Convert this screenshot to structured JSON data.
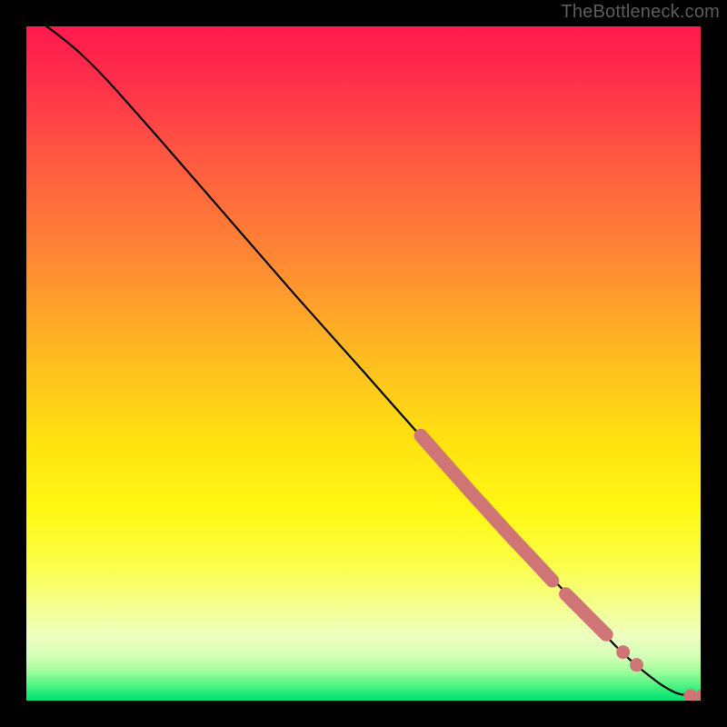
{
  "attribution": "TheBottleneck.com",
  "chart_data": {
    "type": "line",
    "title": "",
    "xlabel": "",
    "ylabel": "",
    "xlim": [
      0,
      100
    ],
    "ylim": [
      0,
      100
    ],
    "grid": false,
    "legend": false,
    "curve": {
      "points_xy": [
        [
          3,
          100
        ],
        [
          5,
          98.5
        ],
        [
          8,
          96
        ],
        [
          12,
          92
        ],
        [
          20,
          83
        ],
        [
          30,
          71.5
        ],
        [
          40,
          60
        ],
        [
          50,
          48.8
        ],
        [
          60,
          37.5
        ],
        [
          70,
          26.5
        ],
        [
          80,
          16
        ],
        [
          88,
          7.5
        ],
        [
          93,
          3.2
        ],
        [
          96,
          1.3
        ],
        [
          98,
          0.8
        ],
        [
          100,
          0.7
        ]
      ]
    },
    "series": [
      {
        "name": "highlight-segment-1",
        "color": "#cf7575",
        "style": "thick-rounded",
        "points_xy": [
          [
            58.5,
            39.3
          ],
          [
            61.5,
            35.9
          ],
          [
            66.0,
            30.8
          ],
          [
            72.0,
            24.2
          ],
          [
            75.5,
            20.5
          ],
          [
            78.0,
            17.8
          ]
        ]
      },
      {
        "name": "highlight-segment-2",
        "color": "#cf7575",
        "style": "thick-rounded",
        "points_xy": [
          [
            80.0,
            15.8
          ],
          [
            83.0,
            12.8
          ],
          [
            86.0,
            9.8
          ]
        ]
      },
      {
        "name": "highlight-dot-1",
        "color": "#cf7575",
        "style": "dot",
        "points_xy": [
          [
            88.5,
            7.2
          ]
        ]
      },
      {
        "name": "highlight-dot-2",
        "color": "#cf7575",
        "style": "dot",
        "points_xy": [
          [
            90.5,
            5.3
          ]
        ]
      },
      {
        "name": "highlight-end-pair",
        "color": "#cf7575",
        "style": "dot",
        "points_xy": [
          [
            98.5,
            0.7
          ],
          [
            100.3,
            0.7
          ]
        ]
      }
    ],
    "background": {
      "type": "vertical-gradient",
      "stops": [
        {
          "t": 0.0,
          "color": "#ff1a4c"
        },
        {
          "t": 0.08,
          "color": "#ff2f4b"
        },
        {
          "t": 0.2,
          "color": "#ff5a41"
        },
        {
          "t": 0.35,
          "color": "#ff8a33"
        },
        {
          "t": 0.5,
          "color": "#ffbf1f"
        },
        {
          "t": 0.62,
          "color": "#ffe310"
        },
        {
          "t": 0.72,
          "color": "#fff814"
        },
        {
          "t": 0.8,
          "color": "#fbff4a"
        },
        {
          "t": 0.86,
          "color": "#f4ff8f"
        },
        {
          "t": 0.905,
          "color": "#edffc0"
        },
        {
          "t": 0.932,
          "color": "#d6ffb8"
        },
        {
          "t": 0.955,
          "color": "#a6ff9e"
        },
        {
          "t": 0.975,
          "color": "#58f585"
        },
        {
          "t": 0.992,
          "color": "#15e877"
        },
        {
          "t": 1.0,
          "color": "#05e173"
        }
      ]
    }
  }
}
